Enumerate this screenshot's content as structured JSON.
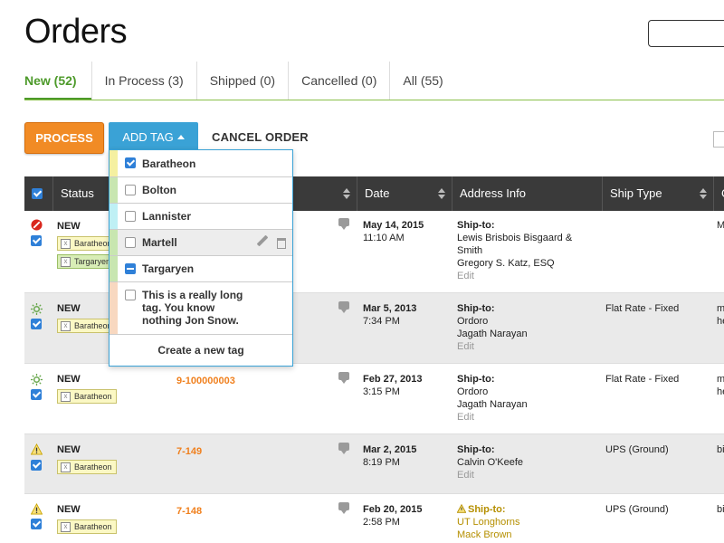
{
  "page": {
    "title": "Orders"
  },
  "search": {
    "placeholder": ""
  },
  "tabs": [
    {
      "label": "New (52)",
      "active": true
    },
    {
      "label": "In Process (3)"
    },
    {
      "label": "Shipped (0)"
    },
    {
      "label": "Cancelled (0)"
    },
    {
      "label": "All (55)"
    }
  ],
  "toolbar": {
    "process_label": "PROCESS",
    "add_tag_label": "ADD TAG",
    "cancel_order_label": "CANCEL ORDER"
  },
  "table": {
    "headers": {
      "status": "Status",
      "date": "Date",
      "address": "Address Info",
      "ship_type": "Ship Type",
      "next": "C"
    }
  },
  "tag_menu": {
    "items": [
      {
        "label": "Baratheon",
        "state": "checked",
        "color": "#f5f0a0"
      },
      {
        "label": "Bolton",
        "state": "unchecked",
        "color": "#c8e6b0"
      },
      {
        "label": "Lannister",
        "state": "unchecked",
        "color": "#bff0f5"
      },
      {
        "label": "Martell",
        "state": "unchecked",
        "color": "#c8e6b0"
      },
      {
        "label": "Targaryen",
        "state": "partial",
        "color": "#c8e6b0"
      },
      {
        "label": "This is a really long tag. You know nothing Jon Snow.",
        "state": "unchecked",
        "color": "#f8d8c0"
      }
    ],
    "create_label": "Create a new tag"
  },
  "orders": [
    {
      "status": "NEW",
      "status_icon": "blocked-icon",
      "tags": [
        "Baratheon",
        "Targaryen"
      ],
      "order_number": "",
      "date": "May 14, 2015",
      "time": "11:10 AM",
      "ship_to_label": "Ship-to:",
      "address_lines": [
        "Lewis Brisbois Bisgaard &",
        "Smith",
        "Gregory S. Katz, ESQ"
      ],
      "edit_label": "Edit",
      "ship_type": "",
      "edge": "M"
    },
    {
      "status": "NEW",
      "status_icon": "sun-icon",
      "tags": [
        "Baratheon"
      ],
      "order_number": "",
      "date": "Mar 5, 2013",
      "time": "7:34 PM",
      "ship_to_label": "Ship-to:",
      "address_lines": [
        "Ordoro",
        "Jagath Narayan"
      ],
      "edit_label": "Edit",
      "ship_type": "Flat Rate - Fixed",
      "edge": "m\nhe"
    },
    {
      "status": "NEW",
      "status_icon": "sun-icon",
      "tags": [
        "Baratheon"
      ],
      "order_number": "9-100000003",
      "date": "Feb 27, 2013",
      "time": "3:15 PM",
      "ship_to_label": "Ship-to:",
      "address_lines": [
        "Ordoro",
        "Jagath Narayan"
      ],
      "edit_label": "Edit",
      "ship_type": "Flat Rate - Fixed",
      "edge": "m\nhe"
    },
    {
      "status": "NEW",
      "status_icon": "warning-icon",
      "tags": [
        "Baratheon"
      ],
      "order_number": "7-149",
      "date": "Mar 2, 2015",
      "time": "8:19 PM",
      "ship_to_label": "Ship-to:",
      "address_lines": [
        "Calvin O'Keefe"
      ],
      "edit_label": "Edit",
      "ship_type": "UPS (Ground)",
      "edge": "bi"
    },
    {
      "status": "NEW",
      "status_icon": "warning-icon",
      "tags": [
        "Baratheon"
      ],
      "order_number": "7-148",
      "date": "Feb 20, 2015",
      "time": "2:58 PM",
      "ship_to_label": "Ship-to:",
      "address_lines": [
        "UT Longhorns",
        "Mack Brown"
      ],
      "edit_label": "",
      "ship_type": "UPS (Ground)",
      "edge": "bi"
    }
  ]
}
